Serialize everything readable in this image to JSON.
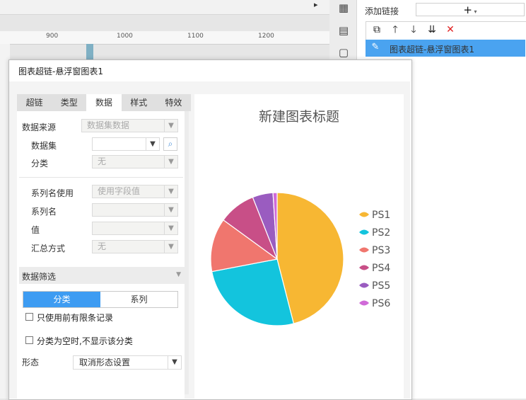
{
  "ruler": {
    "ticks": [
      "900",
      "1000",
      "1100",
      "1200"
    ]
  },
  "right_panel": {
    "add_link_label": "添加链接",
    "add_link_button": "+",
    "toolbar_icons": [
      "copy-icon",
      "arrow-up-icon",
      "arrow-down-icon",
      "sort-down-icon",
      "delete-icon"
    ],
    "link_items": [
      {
        "label": "图表超链-悬浮窗图表1"
      }
    ]
  },
  "dialog": {
    "title": "图表超链-悬浮窗图表1",
    "tabs": [
      "超链",
      "类型",
      "数据",
      "样式",
      "特效"
    ],
    "active_tab": "数据",
    "form": {
      "source_label": "数据来源",
      "source_value": "数据集数据",
      "dataset_label": "数据集",
      "dataset_value": "",
      "category_label": "分类",
      "category_value": "无",
      "series_name_use_label": "系列名使用",
      "series_name_use_value": "使用字段值",
      "series_name_label": "系列名",
      "series_name_value": "",
      "value_label": "值",
      "value_value": "",
      "summary_label": "汇总方式",
      "summary_value": "无"
    },
    "filter": {
      "header": "数据筛选",
      "segments": [
        "分类",
        "系列"
      ],
      "active_segment": "分类",
      "limit_checkbox": "只使用前有限条记录",
      "empty_checkbox": "分类为空时,不显示该分类"
    },
    "shape": {
      "label": "形态",
      "value": "取消形态设置"
    }
  },
  "chart_data": {
    "type": "pie",
    "title": "新建图表标题",
    "legend_position": "right",
    "series": [
      {
        "name": "PS1",
        "value": 46,
        "color": "#f7b733"
      },
      {
        "name": "PS2",
        "value": 26,
        "color": "#13c4dd"
      },
      {
        "name": "PS3",
        "value": 13,
        "color": "#f0766e"
      },
      {
        "name": "PS4",
        "value": 9,
        "color": "#c84f87"
      },
      {
        "name": "PS5",
        "value": 5,
        "color": "#9a5cc0"
      },
      {
        "name": "PS6",
        "value": 1,
        "color": "#d06ad8"
      }
    ]
  }
}
